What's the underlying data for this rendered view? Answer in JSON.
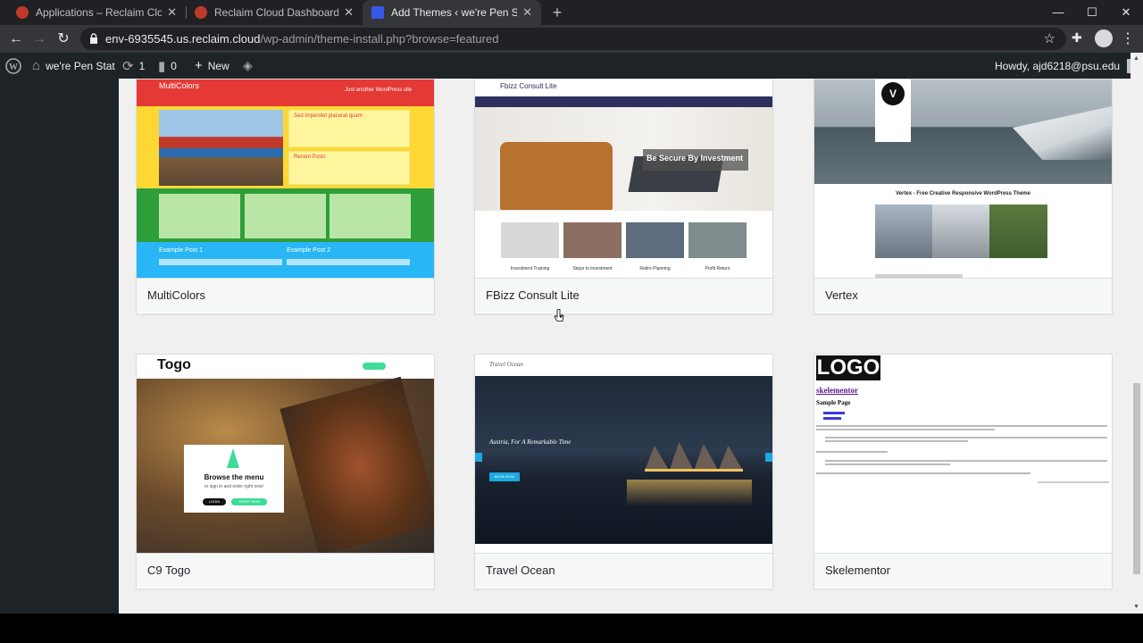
{
  "browser": {
    "tabs": [
      {
        "title": "Applications – Reclaim Cloud",
        "active": false
      },
      {
        "title": "Reclaim Cloud Dashboard",
        "active": false
      },
      {
        "title": "Add Themes ‹ we're Pen Stat — W",
        "active": true
      }
    ],
    "url_host": "env-6935545.us.reclaim.cloud",
    "url_path": "/wp-admin/theme-install.php?browse=featured"
  },
  "adminbar": {
    "site_name": "we're Pen Stat",
    "updates_count": "1",
    "comments_count": "0",
    "new_label": "New",
    "howdy": "Howdy, ajd6218@psu.edu"
  },
  "themes": [
    {
      "name": "MultiColors"
    },
    {
      "name": "FBizz Consult Lite"
    },
    {
      "name": "Vertex"
    },
    {
      "name": "C9 Togo"
    },
    {
      "name": "Travel Ocean"
    },
    {
      "name": "Skelementor"
    }
  ],
  "previews": {
    "multicolors": {
      "title": "MultiColors",
      "tagline": "Just another WordPress site",
      "post_heading": "Sed imperdiet placerat quam",
      "recent_posts": "Recent Posts",
      "example_post_1": "Example Post 1",
      "example_post_2": "Example Post 2"
    },
    "fbizz": {
      "logo": "Fbizz Consult Lite",
      "hero": "Be Secure By Investment",
      "cards": [
        "Investment Training",
        "Steps to investment",
        "Retire Planning",
        "Profit Return"
      ]
    },
    "vertex": {
      "logo_letter": "V",
      "heading": "Vertex - Free Creative Responsive WordPress Theme"
    },
    "togo": {
      "logo": "Togo",
      "menu_title": "Browse the menu",
      "menu_sub": "or sign in and order right now!",
      "login": "LOGIN",
      "start": "START NOW"
    },
    "travel": {
      "logo": "Travel Ocean",
      "headline": "Austria, For A Remarkable Time",
      "book": "BOOK NOW"
    },
    "skelementor": {
      "logo": "LOGO",
      "site": "skelementor",
      "page": "Sample Page"
    }
  },
  "colors": {
    "wp_admin_dark": "#1d2327",
    "content_bg": "#f0f0f1",
    "chrome_dark": "#202124"
  }
}
